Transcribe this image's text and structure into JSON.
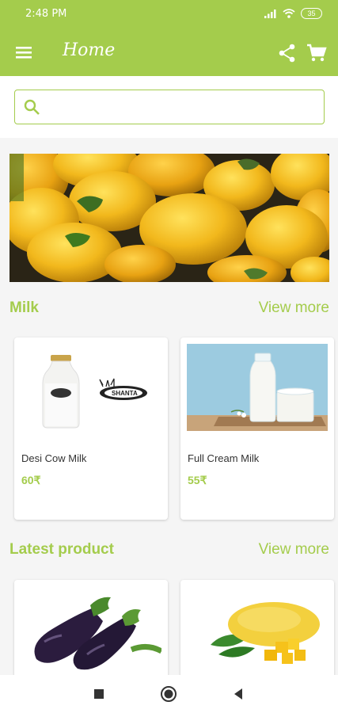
{
  "status_bar": {
    "time": "2:48 PM",
    "battery": "35"
  },
  "header": {
    "title": "Home"
  },
  "search": {
    "placeholder": ""
  },
  "sections": [
    {
      "title": "Milk",
      "view_more": "View more",
      "products": [
        {
          "name": "Desi Cow Milk",
          "price": "60₹"
        },
        {
          "name": "Full Cream Milk",
          "price": "55₹"
        }
      ]
    },
    {
      "title": "Latest product",
      "view_more": "View more",
      "products": [
        {
          "name": "",
          "price": ""
        },
        {
          "name": "",
          "price": ""
        }
      ]
    }
  ],
  "brand_logo_text": "SHANTA",
  "colors": {
    "accent": "#a4cc4c",
    "background": "#f5f5f5"
  },
  "icons": [
    "menu-icon",
    "share-icon",
    "cart-icon",
    "search-icon",
    "nav-square-icon",
    "nav-circle-icon",
    "nav-back-icon"
  ]
}
